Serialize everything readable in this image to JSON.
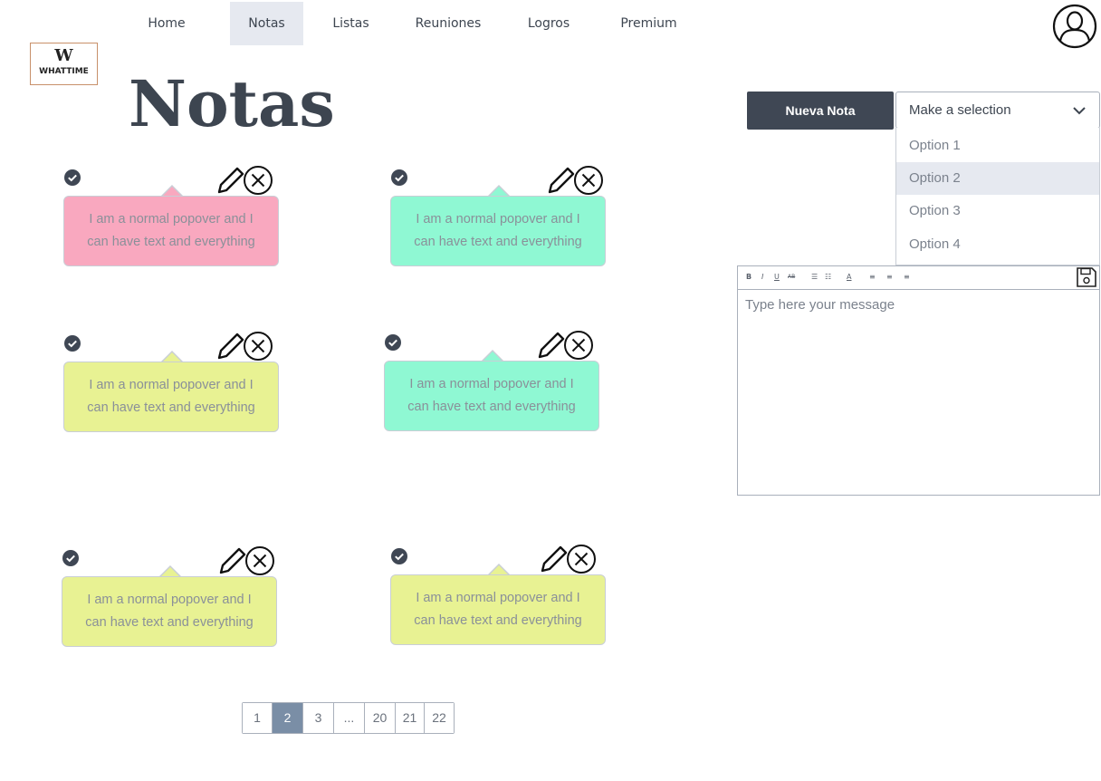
{
  "nav": {
    "items": [
      {
        "label": "Home"
      },
      {
        "label": "Notas"
      },
      {
        "label": "Listas"
      },
      {
        "label": "Reuniones"
      },
      {
        "label": "Logros"
      },
      {
        "label": "Premium"
      }
    ],
    "active": "Notas"
  },
  "logo": {
    "mark": "W",
    "text": "WHATTIME"
  },
  "page": {
    "title": "Notas"
  },
  "notes": [
    {
      "text": "I am a normal popover and I can have text and everything",
      "color": "#f9a8bf"
    },
    {
      "text": "I am a normal popover and I can have text and everything",
      "color": "#8ff8d3"
    },
    {
      "text": "I am a normal popover and I can have text and everything",
      "color": "#e8f293"
    },
    {
      "text": "I am a normal popover and I can have text and everything",
      "color": "#8ff8d3"
    },
    {
      "text": "I am a normal popover and I can have text and everything",
      "color": "#e8f293"
    },
    {
      "text": "I am a normal popover and I can have text and everything",
      "color": "#e8f293"
    }
  ],
  "pagination": {
    "pages": [
      "1",
      "2",
      "3",
      "...",
      "20",
      "21",
      "22"
    ],
    "current": "2"
  },
  "actions": {
    "new_note_label": "Nueva Nota"
  },
  "select": {
    "value": "Make a selection",
    "options": [
      "Option 1",
      "Option 2",
      "Option 3",
      "Option 4"
    ],
    "hovered": "Option 2"
  },
  "editor": {
    "placeholder": "Type here your message",
    "toolbar": [
      "B",
      "I",
      "U",
      "AB",
      "☰",
      "☷",
      "A",
      "≡",
      "≡",
      "≡"
    ]
  },
  "colors": {
    "primary_dark": "#3f4754",
    "nav_active_bg": "#e6e9f0",
    "pager_active_bg": "#7a8ea6"
  },
  "icons": {
    "avatar": "user-circle-icon",
    "note_check": "check-circle-icon",
    "note_edit": "pencil-icon",
    "note_delete": "close-circle-icon",
    "select_caret": "chevron-down-icon",
    "editor_save": "save-icon"
  }
}
